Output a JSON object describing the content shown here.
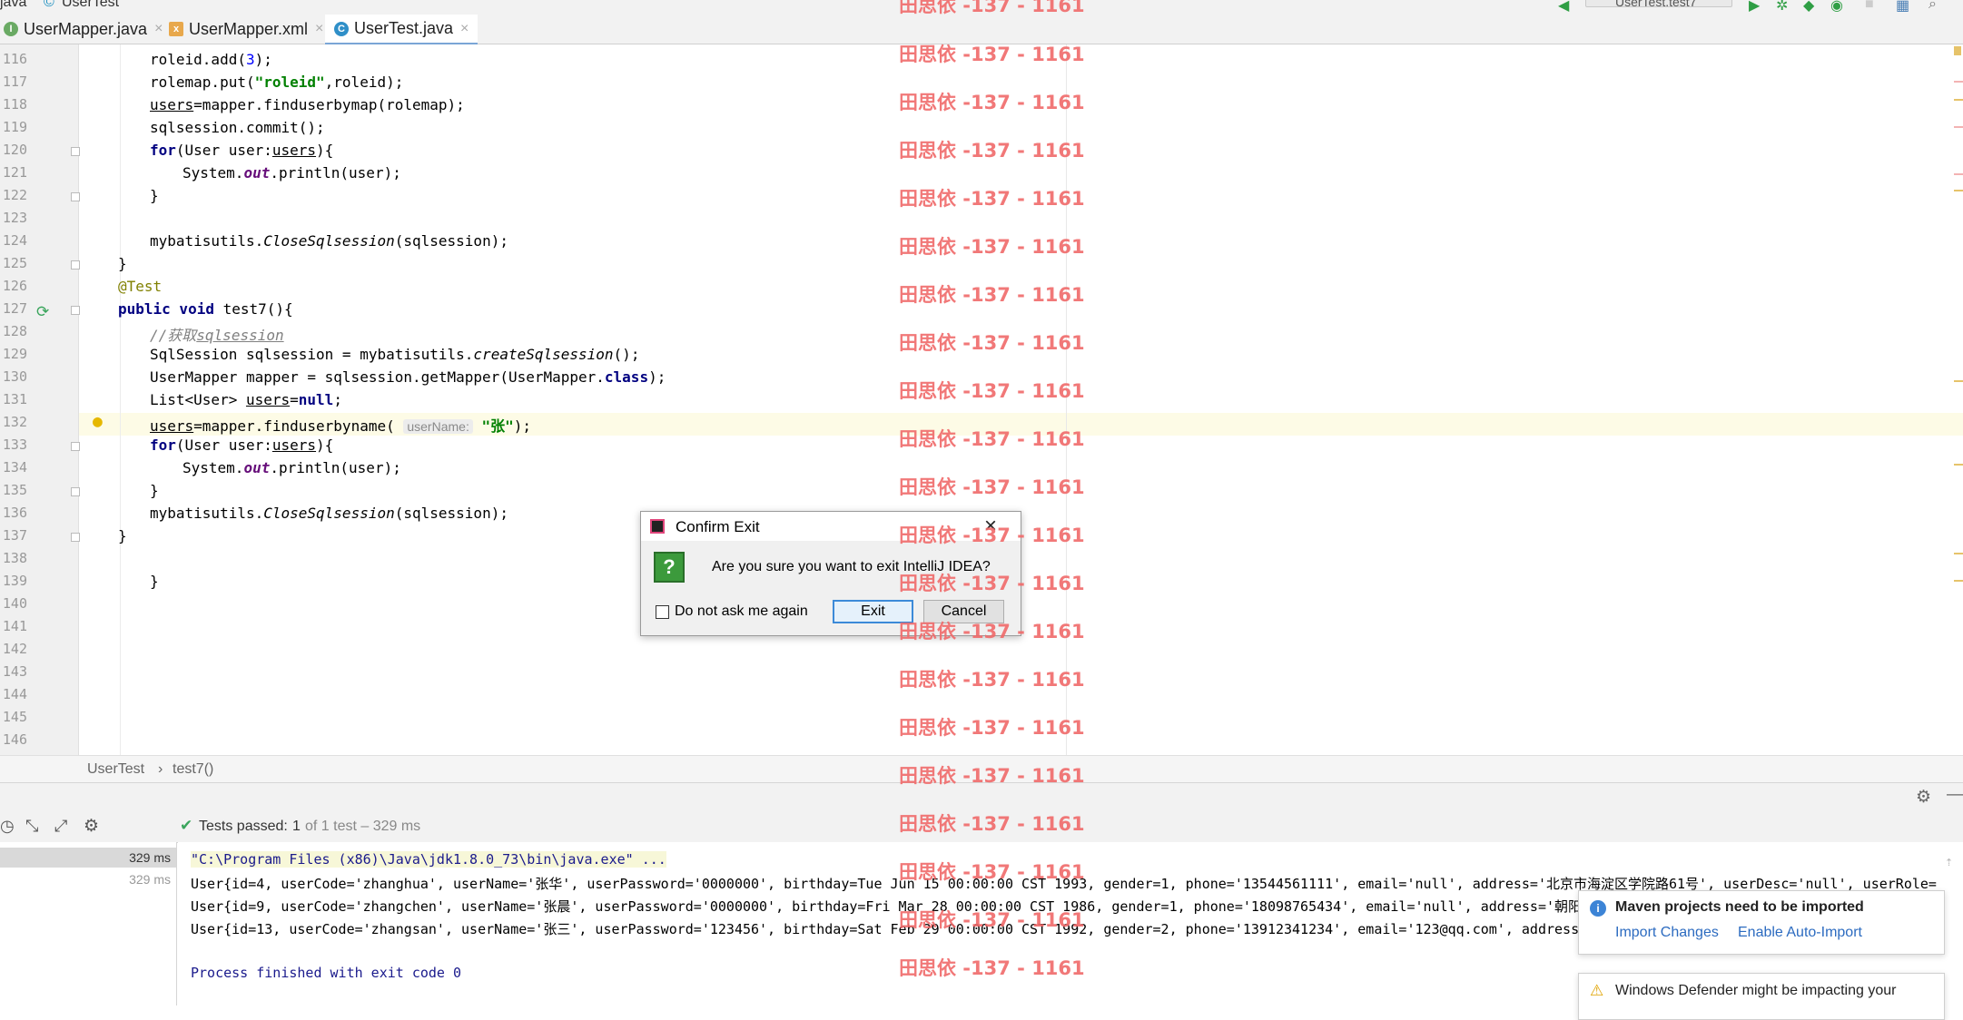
{
  "topbar": {
    "crumb_project": "java",
    "crumb_file": "UserTest",
    "run_config": "UserTest.test7"
  },
  "tabs": [
    {
      "label": "UserMapper.java",
      "badge": "I",
      "close": "×"
    },
    {
      "label": "UserMapper.xml",
      "badge": "x",
      "close": "×"
    },
    {
      "label": "UserTest.java",
      "badge": "C",
      "close": "×"
    }
  ],
  "editor": {
    "line_numbers": [
      "116",
      "117",
      "118",
      "119",
      "120",
      "121",
      "122",
      "123",
      "124",
      "125",
      "126",
      "127",
      "128",
      "129",
      "130",
      "131",
      "132",
      "133",
      "134",
      "135",
      "136",
      "137",
      "138",
      "139",
      "140",
      "141",
      "142",
      "143",
      "144",
      "145",
      "146"
    ],
    "param_hint": "userName:"
  },
  "code": {
    "l116": {
      "a": "roleid.add(",
      "n": "3",
      "b": ");"
    },
    "l117": {
      "a": "rolemap.put(",
      "s": "\"roleid\"",
      "b": ",roleid);"
    },
    "l118": {
      "u": "users",
      "b": "=mapper.finduserbymap(rolemap);"
    },
    "l119": {
      "a": "sqlsession.commit();"
    },
    "l120": {
      "k": "for",
      "a": "(User user:",
      "u": "users",
      "b": "){"
    },
    "l121": {
      "a": "System.",
      "f": "out",
      "b": ".println(user);"
    },
    "l122": {
      "a": "}"
    },
    "l124": {
      "a": "mybatisutils.",
      "i": "CloseSqlsession",
      "b": "(sqlsession);"
    },
    "l125": {
      "a": "}"
    },
    "l126": {
      "anno": "@Test"
    },
    "l127": {
      "k": "public void",
      "a": " test7(){"
    },
    "l128": {
      "c1": "//获取",
      "c2": "sqlsession"
    },
    "l129": {
      "a": "SqlSession sqlsession = mybatisutils.",
      "i": "createSqlsession",
      "b": "();"
    },
    "l130": {
      "a": "UserMapper mapper = sqlsession.getMapper(UserMapper.",
      "k": "class",
      "b": ");"
    },
    "l131": {
      "a": "List<User> ",
      "u": "users",
      "b": "=",
      "k": "null",
      "c": ";"
    },
    "l132": {
      "u": "users",
      "a": "=mapper.finduserbyname( ",
      "s": "\"张\"",
      "b": ");"
    },
    "l133": {
      "k": "for",
      "a": "(User user:",
      "u": "users",
      "b": "){"
    },
    "l134": {
      "a": "System.",
      "f": "out",
      "b": ".println(user);"
    },
    "l135": {
      "a": "}"
    },
    "l136": {
      "a": "mybatisutils.",
      "i": "CloseSqlsession",
      "b": "(sqlsession);"
    },
    "l137": {
      "a": "}"
    },
    "l139": {
      "a": "}"
    }
  },
  "breadcrumb": {
    "class_name": "UserTest",
    "sep": "›",
    "method": "test7()"
  },
  "run": {
    "status": "Tests passed:",
    "count": "1",
    "detail": "of 1 test – 329 ms",
    "tree_rows": [
      "329 ms",
      "329 ms"
    ],
    "console": [
      "\"C:\\Program Files (x86)\\Java\\jdk1.8.0_73\\bin\\java.exe\" ...",
      "User{id=4, userCode='zhanghua', userName='张华', userPassword='0000000', birthday=Tue Jun 15 00:00:00 CST 1993, gender=1, phone='13544561111', email='null', address='北京市海淀区学院路61号', userDesc='null', userRole=",
      "User{id=9, userCode='zhangchen', userName='张晨', userPassword='0000000', birthday=Fri Mar 28 00:00:00 CST 1986, gender=1, phone='18098765434', email='null', address='朝阳",
      "User{id=13, userCode='zhangsan', userName='张三', userPassword='123456', birthday=Sat Feb 29 00:00:00 CST 1992, gender=2, phone='13912341234', email='123@qq.com', address",
      "",
      "Process finished with exit code 0"
    ]
  },
  "dialog": {
    "title": "Confirm Exit",
    "message": "Are you sure you want to exit IntelliJ IDEA?",
    "checkbox_label": "Do not ask me again",
    "exit_label": "Exit",
    "cancel_label": "Cancel",
    "close_glyph": "×"
  },
  "notification": {
    "title": "Maven projects need to be imported",
    "import_link": "Import Changes",
    "auto_link": "Enable Auto-Import"
  },
  "notification2": {
    "title": "Windows Defender might be impacting your"
  },
  "watermark": "田思依 -137 - 1161",
  "colors": {
    "keyword": "#000080",
    "string": "#008000",
    "number": "#0000ff",
    "watermark": "#f06a6a",
    "link": "#2c6bc0"
  }
}
